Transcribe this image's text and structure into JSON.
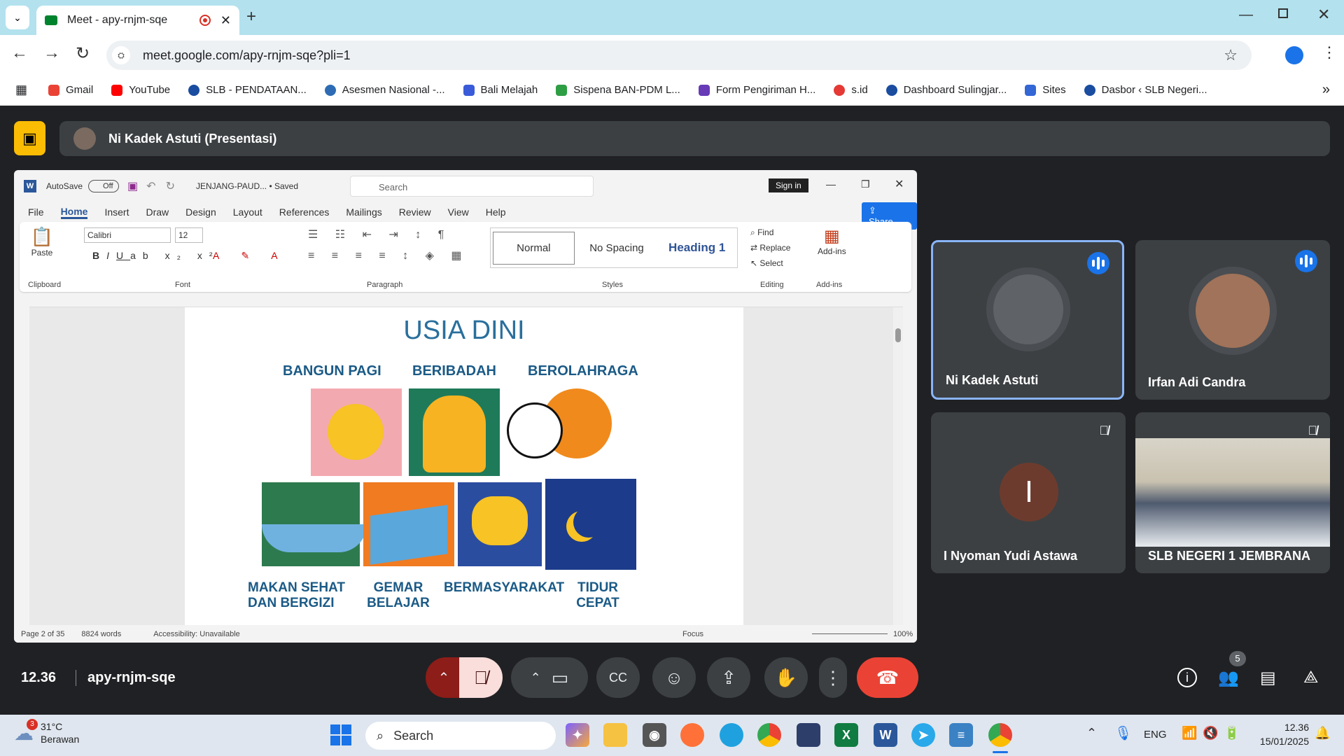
{
  "browser": {
    "tab_title": "Meet - apy-rnjm-sqe",
    "url": "meet.google.com/apy-rnjm-sqe?pli=1",
    "bookmarks": [
      "Gmail",
      "YouTube",
      "SLB - PENDATAAN...",
      "Asesmen Nasional -...",
      "Bali Melajah",
      "Sispena BAN-PDM L...",
      "Form Pengiriman H...",
      "s.id",
      "Dashboard Sulingjar...",
      "Sites",
      "Dasbor ‹ SLB Negeri..."
    ]
  },
  "meet": {
    "presenter": "Ni Kadek Astuti (Presentasi)",
    "time": "12.36",
    "code": "apy-rnjm-sqe",
    "people_count": "5",
    "participants": [
      {
        "name": "Ni Kadek Astuti"
      },
      {
        "name": "Irfan Adi Candra"
      },
      {
        "name": "I Nyoman Yudi Astawa",
        "initial": "I"
      },
      {
        "name": "SLB NEGERI 1 JEMBRANA"
      }
    ]
  },
  "word": {
    "autosave": "AutoSave",
    "autosave_state": "Off",
    "doc_name": "JENJANG-PAUD... • Saved",
    "search": "Search",
    "sign_in": "Sign in",
    "share": "Share",
    "menu": [
      "File",
      "Home",
      "Insert",
      "Draw",
      "Design",
      "Layout",
      "References",
      "Mailings",
      "Review",
      "View",
      "Help"
    ],
    "font": "Calibri",
    "size": "12",
    "paste": "Paste",
    "styles": [
      "Normal",
      "No Spacing",
      "Heading 1"
    ],
    "editing": [
      "Find",
      "Replace",
      "Select"
    ],
    "addins": "Add-ins",
    "groups": [
      "Clipboard",
      "Font",
      "Paragraph",
      "Styles",
      "Editing",
      "Add-ins"
    ],
    "status": {
      "page": "Page 2 of 35",
      "words": "8824 words",
      "accessibility": "Accessibility: Unavailable",
      "focus": "Focus",
      "zoom": "100%"
    },
    "doc_heading": "USIA DINI",
    "habits": [
      "BANGUN PAGI",
      "BERIBADAH",
      "BEROLAHRAGA",
      "MAKAN SEHAT DAN BERGIZI",
      "GEMAR BELAJAR",
      "BERMASYARAKAT",
      "TIDUR CEPAT"
    ]
  },
  "taskbar": {
    "temp": "31°C",
    "weather": "Berawan",
    "search": "Search",
    "lang": "ENG",
    "time": "12.36",
    "date": "15/01/2025",
    "badge": "3"
  },
  "colors": {
    "meet_bg": "#202124",
    "end_call": "#ea4335",
    "accent": "#1a73e8",
    "word_blue": "#2b579a"
  }
}
